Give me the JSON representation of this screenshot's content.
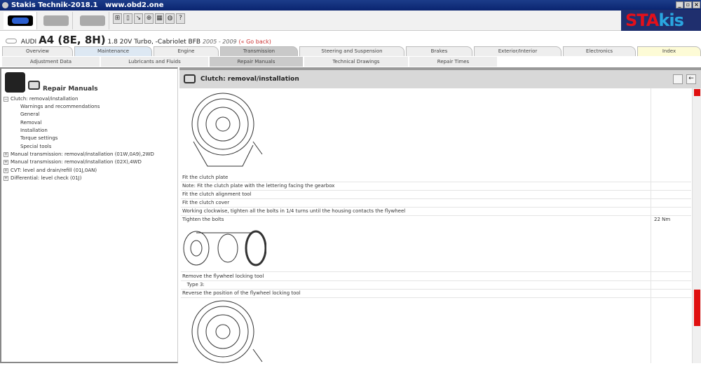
{
  "window": {
    "title": "Stakis Technik-2018.1   www.obd2.one",
    "min": "_",
    "max": "▫",
    "close": "×"
  },
  "brand": {
    "sta": "STA",
    "kis": "kis"
  },
  "vehicle": {
    "make": "AUDI",
    "model": "A4 (8E, 8H)",
    "engine": "1.8 20V Turbo, -Cabriolet BFB",
    "years": "2005 - 2009",
    "back": "(« Go back)"
  },
  "tabs": [
    "Overview",
    "Maintenance",
    "Engine",
    "Transmission",
    "Steering and Suspension",
    "Brakes",
    "Exterior/Interior",
    "Electronics",
    "Index"
  ],
  "subtabs": [
    "Adjustment Data",
    "Lubricants and Fluids",
    "Repair Manuals",
    "Technical Drawings",
    "Repair Times"
  ],
  "sidebar": {
    "title": "Repair Manuals",
    "tree": [
      {
        "pm": "−",
        "label": "Clutch: removal/installation"
      }
    ],
    "children": [
      "Warnings and recommendations",
      "General",
      "Removal",
      "Installation",
      "Torque settings",
      "Special tools"
    ],
    "others": [
      "Manual transmission: removal/installation (01W,0A9),2WD",
      "Manual transmission: removal/installation (02X),4WD",
      "CVT: level and drain/refill (01J,0AN)",
      "Differential: level check (01J)"
    ],
    "plus": "+"
  },
  "content": {
    "title": "Clutch: removal/installation",
    "rows": [
      {
        "text": "Fit the clutch plate",
        "value": ""
      },
      {
        "text": "Note: Fit the clutch plate with the lettering facing the gearbox",
        "value": ""
      },
      {
        "text": "Fit the clutch alignment tool",
        "value": ""
      },
      {
        "text": "Fit the clutch cover",
        "value": ""
      },
      {
        "text": "Working clockwise, tighten all the bolts in 1/4 turns until the housing contacts the flywheel",
        "value": ""
      },
      {
        "text": "Tighten the bolts",
        "value": "22 Nm"
      }
    ],
    "rows2": [
      {
        "text": "Remove the flywheel locking tool"
      },
      {
        "text": "   Type 3:"
      },
      {
        "text": "Reverse the position of the flywheel locking tool"
      }
    ]
  }
}
